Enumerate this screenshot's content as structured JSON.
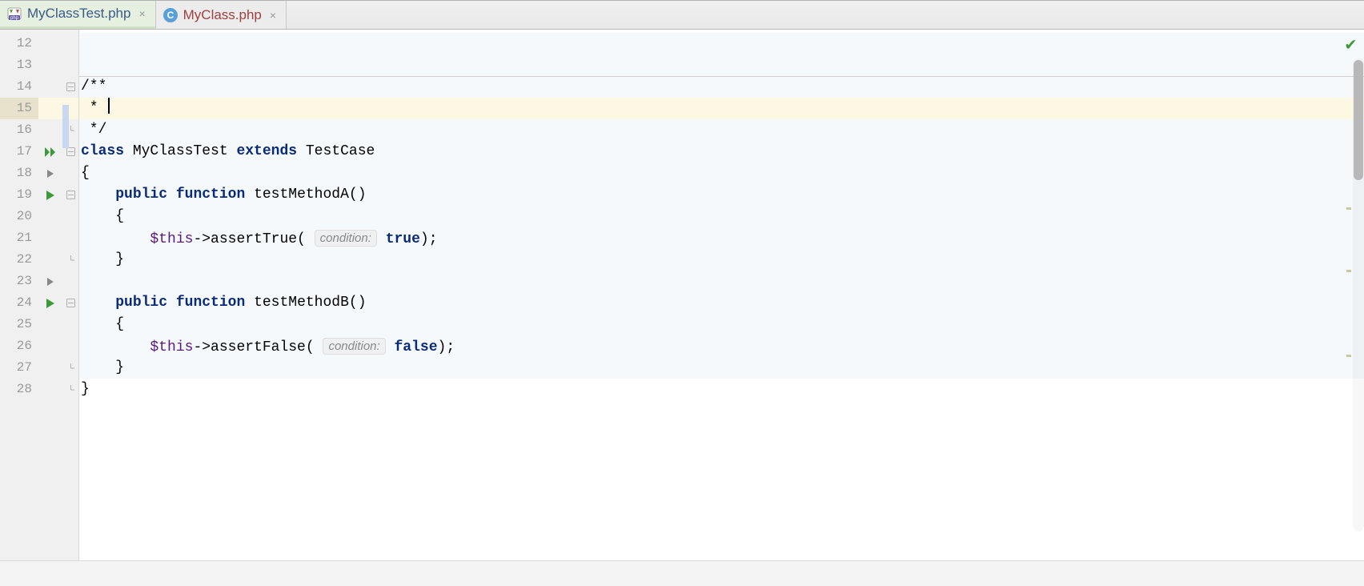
{
  "tabs": [
    {
      "label": "MyClassTest.php",
      "active": true,
      "icon": "php"
    },
    {
      "label": "MyClass.php",
      "active": false,
      "icon": "class"
    }
  ],
  "line_numbers": [
    "12",
    "13",
    "14",
    "15",
    "16",
    "17",
    "18",
    "19",
    "20",
    "21",
    "22",
    "23",
    "24",
    "25",
    "26",
    "27",
    "28"
  ],
  "markers": {
    "17": "run-all",
    "18": "collapse",
    "19": "run",
    "23": "collapse",
    "24": "run"
  },
  "folds": {
    "14": "start",
    "16": "end",
    "17": "start",
    "19": "start",
    "22": "end",
    "24": "start",
    "27": "end",
    "28": "end"
  },
  "code": {
    "l12": "",
    "l13": "",
    "l14_open": "/**",
    "l15_star": " * ",
    "l16_close": " */",
    "l17_class": "class",
    "l17_name": " MyClassTest ",
    "l17_extends": "extends",
    "l17_parent": " TestCase",
    "l18": "{",
    "l19_indent": "    ",
    "l19_public": "public",
    "l19_sp": " ",
    "l19_function": "function",
    "l19_sig": " testMethodA()",
    "l20": "    {",
    "l21_pre": "        ",
    "l21_this": "$this",
    "l21_call": "->assertTrue( ",
    "l21_hint": "condition:",
    "l21_sp": " ",
    "l21_true": "true",
    "l21_end": ");",
    "l22": "    }",
    "l23": "",
    "l24_indent": "    ",
    "l24_public": "public",
    "l24_sp": " ",
    "l24_function": "function",
    "l24_sig": " testMethodB()",
    "l25": "    {",
    "l26_pre": "        ",
    "l26_this": "$this",
    "l26_call": "->assertFalse( ",
    "l26_hint": "condition:",
    "l26_sp": " ",
    "l26_false": "false",
    "l26_end": ");",
    "l27": "    }",
    "l28": "}"
  },
  "current_line": 15,
  "light_bg_lines": [
    12,
    13,
    14,
    16,
    17,
    18,
    19,
    20,
    21,
    22,
    23,
    24,
    25,
    26,
    27
  ],
  "validation": "ok"
}
